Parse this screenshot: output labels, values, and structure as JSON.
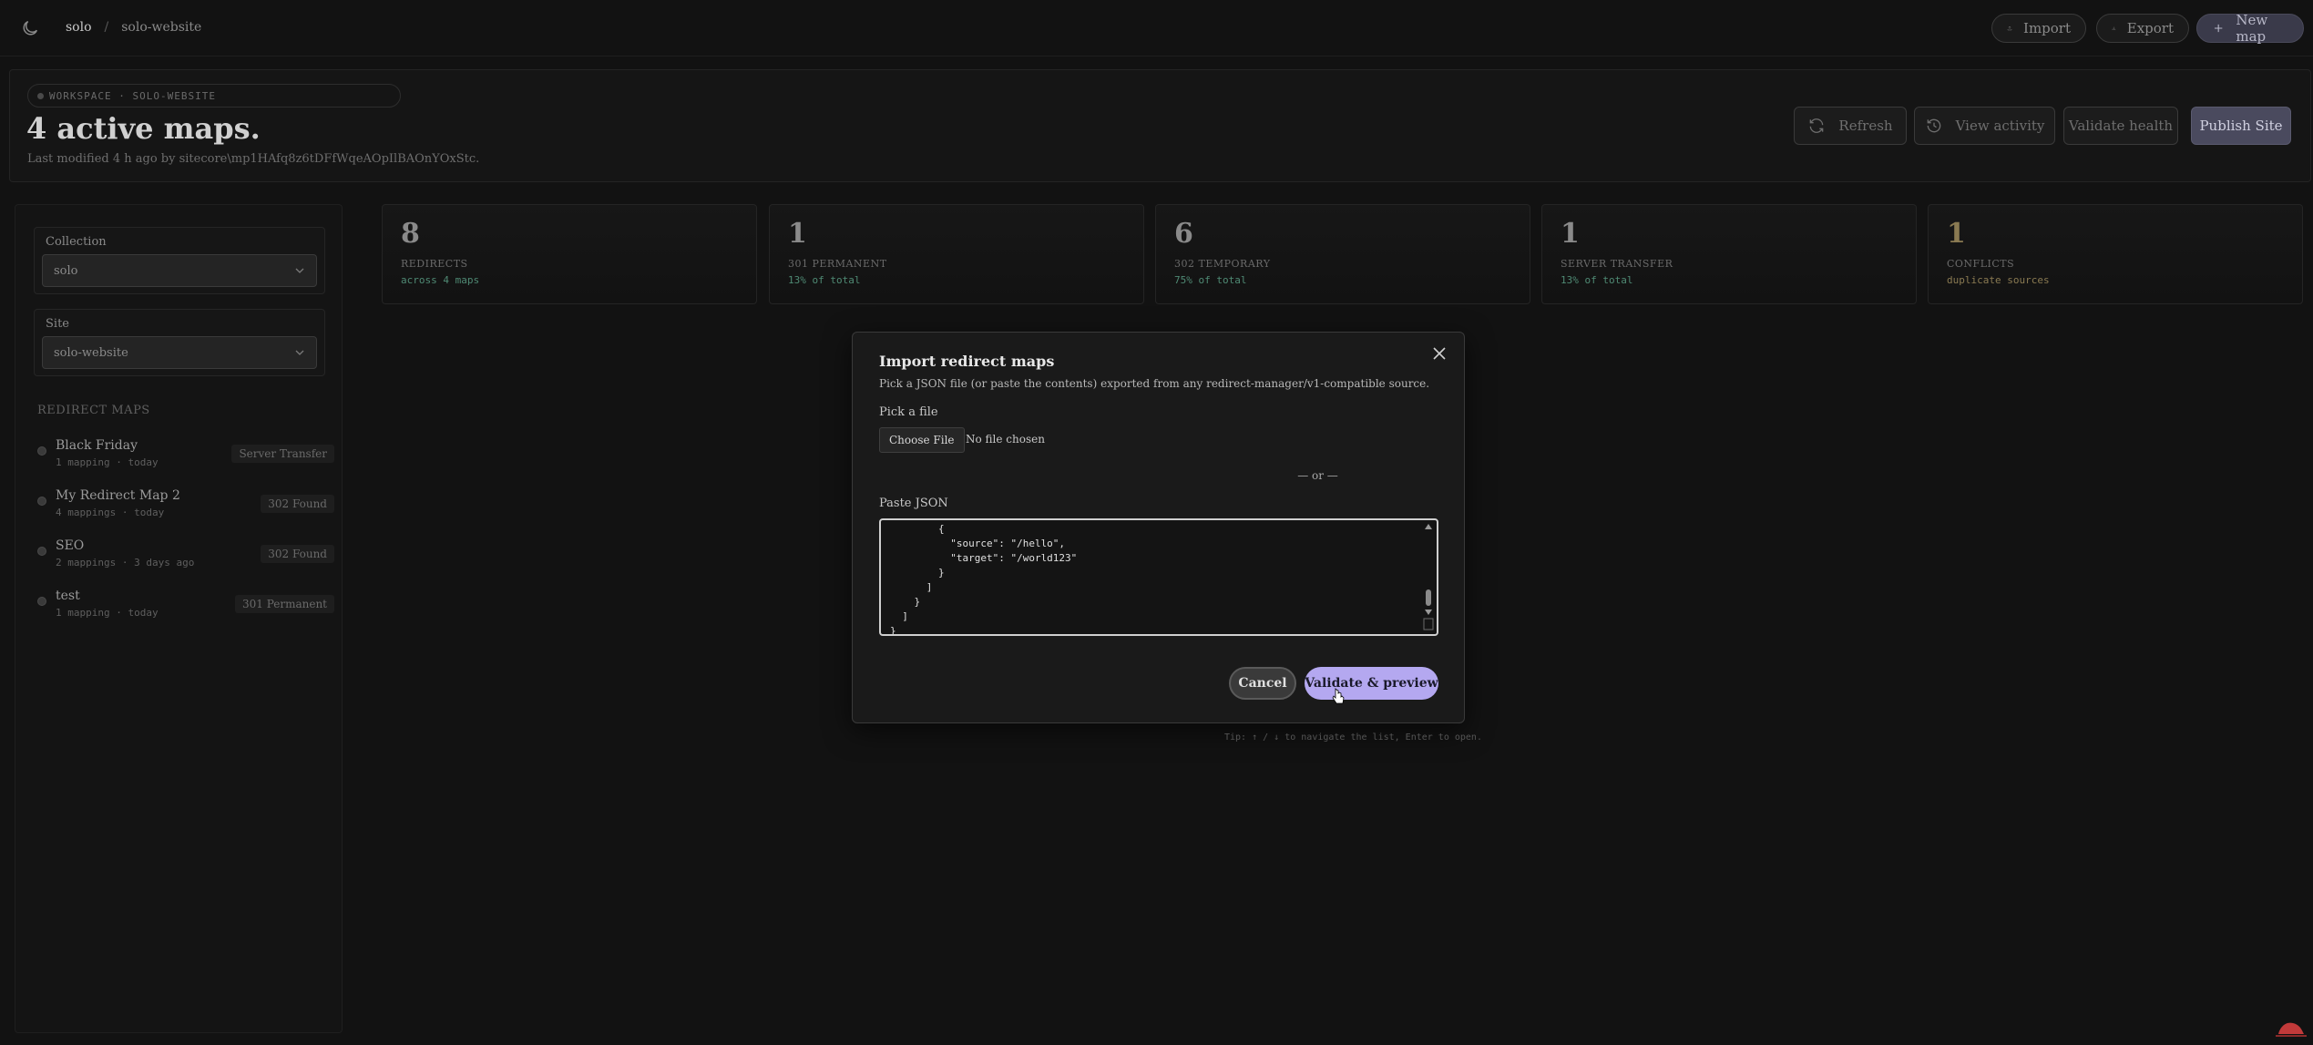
{
  "topbar": {
    "breadcrumb": [
      "solo",
      "solo-website"
    ],
    "separator": "/",
    "import_label": "Import",
    "export_label": "Export",
    "new_map_label": "New map"
  },
  "header": {
    "workspace_pill": "WORKSPACE · SOLO-WEBSITE",
    "title": "4 active maps.",
    "last_modified": "Last modified 4 h ago by sitecore\\mp1HAfq8z6tDFfWqeAOpIlBAOnYOxStc.",
    "refresh_label": "Refresh",
    "view_activity_label": "View activity",
    "validate_health_label": "Validate health",
    "publish_label": "Publish Site"
  },
  "sidebar": {
    "collection_label": "Collection",
    "collection_value": "solo",
    "site_label": "Site",
    "site_value": "solo-website",
    "section_label": "REDIRECT MAPS",
    "maps": [
      {
        "name": "Black Friday",
        "meta": "1 mapping · today",
        "badge": "Server Transfer"
      },
      {
        "name": "My Redirect Map 2",
        "meta": "4 mappings · today",
        "badge": "302 Found"
      },
      {
        "name": "SEO",
        "meta": "2 mappings · 3 days ago",
        "badge": "302 Found"
      },
      {
        "name": "test",
        "meta": "1 mapping · today",
        "badge": "301 Permanent"
      }
    ]
  },
  "stats": [
    {
      "value": "8",
      "label": "REDIRECTS",
      "sub": "across 4 maps"
    },
    {
      "value": "1",
      "label": "301 PERMANENT",
      "sub": "13% of total"
    },
    {
      "value": "6",
      "label": "302 TEMPORARY",
      "sub": "75% of total"
    },
    {
      "value": "1",
      "label": "SERVER TRANSFER",
      "sub": "13% of total"
    },
    {
      "value": "1",
      "label": "CONFLICTS",
      "sub": "duplicate sources"
    }
  ],
  "modal": {
    "title": "Import redirect maps",
    "description": "Pick a JSON file (or paste the contents) exported from any redirect-manager/v1-compatible source.",
    "pick_label": "Pick a file",
    "choose_file_label": "Choose File",
    "no_file_label": "No file chosen",
    "or_label": "— or —",
    "paste_label": "Paste JSON",
    "json_text": "        {\n          \"source\": \"/hello\",\n          \"target\": \"/world123\"\n        }\n      ]\n    }\n  ]\n}",
    "cancel_label": "Cancel",
    "validate_label": "Validate & preview"
  },
  "tip": "Tip: ↑ / ↓ to navigate the list, Enter to open.",
  "colors": {
    "accent": "#b4a8f0",
    "positive": "#4f8a74",
    "warning": "#8a7a52"
  }
}
